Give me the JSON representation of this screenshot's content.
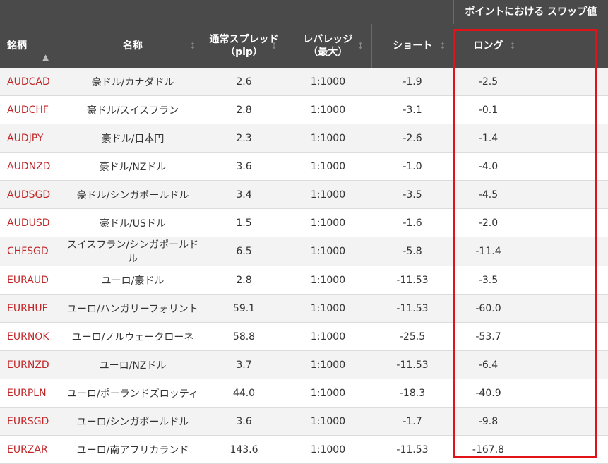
{
  "table": {
    "group_header": "ポイントにおける スワップ値",
    "columns": {
      "symbol": "銘柄",
      "name": "名称",
      "spread": "通常スプレッド（pip）",
      "leverage_line1": "レバレッジ",
      "leverage_line2": "（最大）",
      "short": "ショート",
      "long": "ロング"
    },
    "icons": {
      "sort_up": "chevron-up-icon",
      "sort_both": "sort-arrows-icon"
    },
    "rows": [
      {
        "symbol": "AUDCAD",
        "name": "豪ドル/カナダドル",
        "spread": "2.6",
        "leverage": "1:1000",
        "short": "-1.9",
        "long": "-2.5"
      },
      {
        "symbol": "AUDCHF",
        "name": "豪ドル/スイスフラン",
        "spread": "2.8",
        "leverage": "1:1000",
        "short": "-3.1",
        "long": "-0.1"
      },
      {
        "symbol": "AUDJPY",
        "name": "豪ドル/日本円",
        "spread": "2.3",
        "leverage": "1:1000",
        "short": "-2.6",
        "long": "-1.4"
      },
      {
        "symbol": "AUDNZD",
        "name": "豪ドル/NZドル",
        "spread": "3.6",
        "leverage": "1:1000",
        "short": "-1.0",
        "long": "-4.0"
      },
      {
        "symbol": "AUDSGD",
        "name": "豪ドル/シンガポールドル",
        "spread": "3.4",
        "leverage": "1:1000",
        "short": "-3.5",
        "long": "-4.5"
      },
      {
        "symbol": "AUDUSD",
        "name": "豪ドル/USドル",
        "spread": "1.5",
        "leverage": "1:1000",
        "short": "-1.6",
        "long": "-2.0"
      },
      {
        "symbol": "CHFSGD",
        "name": "スイスフラン/シンガポールドル",
        "spread": "6.5",
        "leverage": "1:1000",
        "short": "-5.8",
        "long": "-11.4"
      },
      {
        "symbol": "EURAUD",
        "name": "ユーロ/豪ドル",
        "spread": "2.8",
        "leverage": "1:1000",
        "short": "-11.53",
        "long": "-3.5"
      },
      {
        "symbol": "EURHUF",
        "name": "ユーロ/ハンガリーフォリント",
        "spread": "59.1",
        "leverage": "1:1000",
        "short": "-11.53",
        "long": "-60.0"
      },
      {
        "symbol": "EURNOK",
        "name": "ユーロ/ノルウェークローネ",
        "spread": "58.8",
        "leverage": "1:1000",
        "short": "-25.5",
        "long": "-53.7"
      },
      {
        "symbol": "EURNZD",
        "name": "ユーロ/NZドル",
        "spread": "3.7",
        "leverage": "1:1000",
        "short": "-11.53",
        "long": "-6.4"
      },
      {
        "symbol": "EURPLN",
        "name": "ユーロ/ポーランドズロッティ",
        "spread": "44.0",
        "leverage": "1:1000",
        "short": "-18.3",
        "long": "-40.9"
      },
      {
        "symbol": "EURSGD",
        "name": "ユーロ/シンガポールドル",
        "spread": "3.6",
        "leverage": "1:1000",
        "short": "-1.7",
        "long": "-9.8"
      },
      {
        "symbol": "EURZAR",
        "name": "ユーロ/南アフリカランド",
        "spread": "143.6",
        "leverage": "1:1000",
        "short": "-11.53",
        "long": "-167.8"
      }
    ]
  },
  "colors": {
    "header_bg": "#4a4a4a",
    "symbol_text": "#c0282a",
    "highlight_border": "#e01418"
  }
}
